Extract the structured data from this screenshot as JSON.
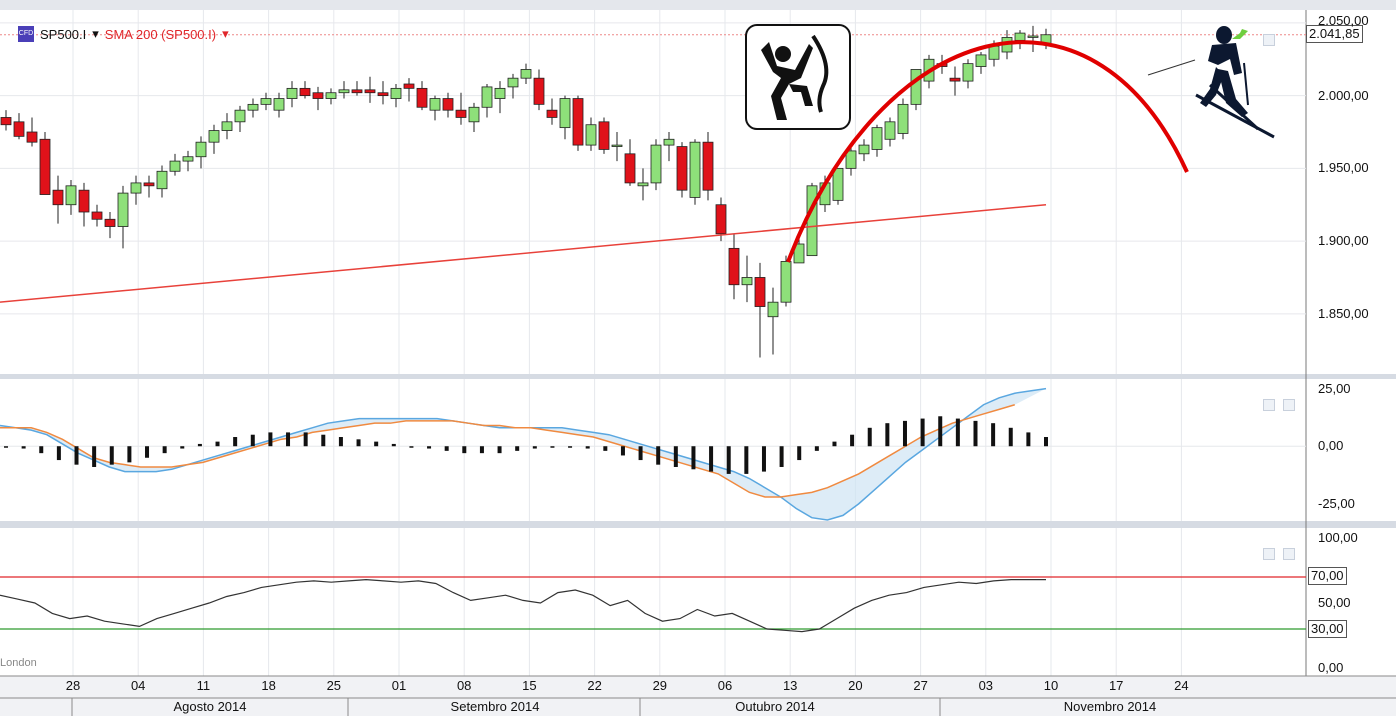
{
  "toolbar": {
    "symbol": "SP500.I",
    "indicator": "SMA 200 (SP500.I)",
    "last_price": "2.041,85"
  },
  "colors": {
    "bull": "#8ee07a",
    "bear": "#e0121a",
    "sma": "#e8413a",
    "macd_line": "#5aa7e0",
    "signal_line": "#f08a40",
    "rsi_line": "#333333",
    "overbought": "#e0262a",
    "oversold": "#2e9a2e",
    "arc": "#e00000"
  },
  "icons": [
    "instrument-icon",
    "climber-icon",
    "skier-icon"
  ],
  "watermark": "London",
  "chart_data": [
    {
      "type": "candlestick",
      "ylim": [
        1810,
        2052
      ],
      "yticks": [
        "1.850,00",
        "1.900,00",
        "1.950,00",
        "2.000,00",
        "2.050,00"
      ],
      "ytick_values": [
        1850,
        1900,
        1950,
        2000,
        2050
      ],
      "series": [
        {
          "name": "SP500.I",
          "ohlc": [
            [
              1985,
              1990,
              1976,
              1980
            ],
            [
              1982,
              1988,
              1970,
              1972
            ],
            [
              1975,
              1985,
              1965,
              1968
            ],
            [
              1970,
              1975,
              1940,
              1932
            ],
            [
              1935,
              1945,
              1912,
              1925
            ],
            [
              1925,
              1942,
              1918,
              1938
            ],
            [
              1935,
              1940,
              1910,
              1920
            ],
            [
              1920,
              1925,
              1910,
              1915
            ],
            [
              1915,
              1920,
              1902,
              1910
            ],
            [
              1910,
              1938,
              1895,
              1933
            ],
            [
              1933,
              1945,
              1925,
              1940
            ],
            [
              1940,
              1945,
              1930,
              1938
            ],
            [
              1936,
              1952,
              1930,
              1948
            ],
            [
              1948,
              1960,
              1945,
              1955
            ],
            [
              1955,
              1962,
              1948,
              1958
            ],
            [
              1958,
              1972,
              1950,
              1968
            ],
            [
              1968,
              1980,
              1960,
              1976
            ],
            [
              1976,
              1988,
              1970,
              1982
            ],
            [
              1982,
              1993,
              1975,
              1990
            ],
            [
              1990,
              1998,
              1985,
              1994
            ],
            [
              1994,
              2002,
              1990,
              1998
            ],
            [
              1990,
              2002,
              1985,
              1998
            ],
            [
              1998,
              2010,
              1992,
              2005
            ],
            [
              2005,
              2010,
              1998,
              2000
            ],
            [
              2002,
              2006,
              1990,
              1998
            ],
            [
              1998,
              2005,
              1994,
              2002
            ],
            [
              2002,
              2010,
              1998,
              2004
            ],
            [
              2004,
              2010,
              2000,
              2002
            ],
            [
              2004,
              2013,
              1995,
              2002
            ],
            [
              2002,
              2010,
              1994,
              2000
            ],
            [
              1998,
              2008,
              1992,
              2005
            ],
            [
              2008,
              2012,
              1996,
              2005
            ],
            [
              2005,
              2010,
              1990,
              1992
            ],
            [
              1990,
              2000,
              1983,
              1998
            ],
            [
              1998,
              2002,
              1985,
              1990
            ],
            [
              1990,
              2002,
              1980,
              1985
            ],
            [
              1982,
              1995,
              1975,
              1992
            ],
            [
              1992,
              2008,
              1985,
              2006
            ],
            [
              1998,
              2010,
              1988,
              2005
            ],
            [
              2006,
              2015,
              1998,
              2012
            ],
            [
              2012,
              2022,
              2008,
              2018
            ],
            [
              2012,
              2018,
              1990,
              1994
            ],
            [
              1990,
              1998,
              1980,
              1985
            ],
            [
              1978,
              2000,
              1970,
              1998
            ],
            [
              1998,
              2000,
              1962,
              1966
            ],
            [
              1966,
              1985,
              1962,
              1980
            ],
            [
              1982,
              1985,
              1960,
              1963
            ],
            [
              1965,
              1975,
              1955,
              1966
            ],
            [
              1960,
              1970,
              1938,
              1940
            ],
            [
              1938,
              1950,
              1928,
              1940
            ],
            [
              1940,
              1970,
              1935,
              1966
            ],
            [
              1966,
              1975,
              1955,
              1970
            ],
            [
              1965,
              1968,
              1930,
              1935
            ],
            [
              1930,
              1970,
              1925,
              1968
            ],
            [
              1968,
              1975,
              1928,
              1935
            ],
            [
              1925,
              1930,
              1900,
              1905
            ],
            [
              1895,
              1905,
              1860,
              1870
            ],
            [
              1870,
              1890,
              1858,
              1875
            ],
            [
              1875,
              1885,
              1820,
              1855
            ],
            [
              1848,
              1868,
              1822,
              1858
            ],
            [
              1858,
              1890,
              1855,
              1886
            ],
            [
              1885,
              1902,
              1890,
              1898
            ],
            [
              1890,
              1940,
              1890,
              1938
            ],
            [
              1925,
              1945,
              1920,
              1940
            ],
            [
              1928,
              1950,
              1925,
              1950
            ],
            [
              1950,
              1965,
              1945,
              1962
            ],
            [
              1960,
              1970,
              1955,
              1966
            ],
            [
              1963,
              1980,
              1958,
              1978
            ],
            [
              1970,
              1985,
              1965,
              1982
            ],
            [
              1974,
              1998,
              1970,
              1994
            ],
            [
              1994,
              2012,
              1990,
              2018
            ],
            [
              2010,
              2028,
              2005,
              2025
            ],
            [
              2022,
              2028,
              2015,
              2020
            ],
            [
              2012,
              2020,
              2000,
              2010
            ],
            [
              2010,
              2025,
              2005,
              2022
            ],
            [
              2020,
              2030,
              2015,
              2028
            ],
            [
              2025,
              2038,
              2020,
              2034
            ],
            [
              2030,
              2045,
              2025,
              2040
            ],
            [
              2038,
              2045,
              2032,
              2043
            ],
            [
              2040,
              2048,
              2030,
              2041
            ],
            [
              2036,
              2046,
              2032,
              2041.85
            ]
          ]
        },
        {
          "name": "SMA 200 (SP500.I)",
          "values": [
            1858,
            1925
          ]
        }
      ]
    },
    {
      "type": "line",
      "ylim": [
        -32,
        27
      ],
      "yticks": [
        "-25,00",
        "0,00",
        "25,00"
      ],
      "ytick_values": [
        -25,
        0,
        25
      ],
      "series": [
        {
          "name": "macd",
          "values": [
            9,
            8,
            7,
            5,
            1,
            -3,
            -6,
            -9,
            -11,
            -11,
            -11,
            -10,
            -8,
            -6,
            -4,
            -2,
            0,
            2,
            4,
            6,
            8,
            10,
            11,
            12,
            12,
            12,
            12,
            12,
            12,
            11,
            10,
            9,
            8,
            8,
            8,
            8,
            8,
            7,
            6,
            5,
            3,
            1,
            -1,
            -3,
            -5,
            -7,
            -9,
            -11,
            -14,
            -18,
            -22,
            -27,
            -31,
            -32,
            -30,
            -25,
            -19,
            -13,
            -7,
            -2,
            3,
            8,
            13,
            18,
            21,
            23,
            24,
            25
          ]
        },
        {
          "name": "signal",
          "values": [
            8,
            8,
            8,
            6,
            3,
            -1,
            -5,
            -7,
            -8,
            -9,
            -9,
            -9,
            -8,
            -7,
            -5,
            -3,
            -1,
            1,
            3,
            4,
            6,
            7,
            8,
            9,
            10,
            10,
            11,
            11,
            11,
            11,
            10,
            9,
            9,
            8,
            8,
            7,
            6,
            5,
            4,
            2,
            0,
            -2,
            -4,
            -6,
            -8,
            -10,
            -12,
            -16,
            -20,
            -22,
            -22,
            -21,
            -20,
            -18,
            -15,
            -12,
            -8,
            -4,
            0,
            4,
            7,
            10,
            12,
            14,
            16,
            18
          ]
        },
        {
          "name": "histogram",
          "values": [
            0,
            -1,
            -3,
            -6,
            -8,
            -9,
            -8,
            -7,
            -5,
            -3,
            -1,
            1,
            2,
            4,
            5,
            6,
            6,
            6,
            5,
            4,
            3,
            2,
            1,
            0,
            -1,
            -2,
            -3,
            -3,
            -3,
            -2,
            -1,
            0,
            0,
            -1,
            -2,
            -4,
            -6,
            -8,
            -9,
            -10,
            -11,
            -12,
            -12,
            -11,
            -9,
            -6,
            -2,
            2,
            5,
            8,
            10,
            11,
            12,
            13,
            12,
            11,
            10,
            8,
            6,
            4
          ]
        }
      ]
    },
    {
      "type": "line",
      "ylim": [
        0,
        100
      ],
      "yticks": [
        "0,00",
        "50,00",
        "100,00"
      ],
      "ytick_values": [
        0,
        50,
        100
      ],
      "levels": [
        {
          "value": 70,
          "label": "70,00"
        },
        {
          "value": 30,
          "label": "30,00"
        }
      ],
      "series": [
        {
          "name": "rsi",
          "values": [
            56,
            53,
            50,
            42,
            38,
            40,
            36,
            34,
            32,
            38,
            42,
            46,
            50,
            55,
            58,
            62,
            64,
            66,
            67,
            66,
            67,
            68,
            67,
            66,
            67,
            65,
            58,
            52,
            54,
            56,
            52,
            50,
            58,
            60,
            56,
            48,
            52,
            42,
            36,
            38,
            45,
            40,
            42,
            36,
            30,
            29,
            28,
            30,
            38,
            46,
            52,
            56,
            58,
            62,
            64,
            66,
            65,
            67,
            68,
            68,
            68
          ]
        }
      ]
    }
  ],
  "xaxis": {
    "day_labels": [
      "28",
      "04",
      "11",
      "18",
      "25",
      "01",
      "08",
      "15",
      "22",
      "29",
      "06",
      "13",
      "20",
      "27",
      "03",
      "10",
      "17",
      "24"
    ],
    "month_labels": [
      "Agosto 2014",
      "Setembro 2014",
      "Outubro 2014",
      "Novembro 2014"
    ]
  }
}
